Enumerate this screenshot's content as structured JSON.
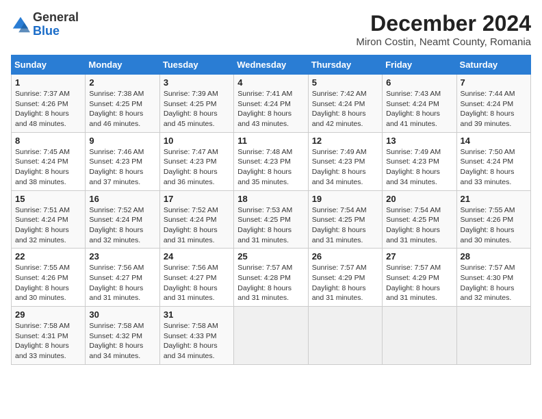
{
  "header": {
    "logo": {
      "general": "General",
      "blue": "Blue"
    },
    "title": "December 2024",
    "subtitle": "Miron Costin, Neamt County, Romania"
  },
  "calendar": {
    "days_of_week": [
      "Sunday",
      "Monday",
      "Tuesday",
      "Wednesday",
      "Thursday",
      "Friday",
      "Saturday"
    ],
    "weeks": [
      [
        {
          "day": "",
          "empty": true
        },
        {
          "day": "",
          "empty": true
        },
        {
          "day": "",
          "empty": true
        },
        {
          "day": "",
          "empty": true
        },
        {
          "day": "",
          "empty": true
        },
        {
          "day": "",
          "empty": true
        },
        {
          "day": "",
          "empty": true
        }
      ],
      [
        {
          "day": "1",
          "sunrise": "7:37 AM",
          "sunset": "4:26 PM",
          "daylight": "8 hours and 48 minutes."
        },
        {
          "day": "2",
          "sunrise": "7:38 AM",
          "sunset": "4:25 PM",
          "daylight": "8 hours and 46 minutes."
        },
        {
          "day": "3",
          "sunrise": "7:39 AM",
          "sunset": "4:25 PM",
          "daylight": "8 hours and 45 minutes."
        },
        {
          "day": "4",
          "sunrise": "7:41 AM",
          "sunset": "4:24 PM",
          "daylight": "8 hours and 43 minutes."
        },
        {
          "day": "5",
          "sunrise": "7:42 AM",
          "sunset": "4:24 PM",
          "daylight": "8 hours and 42 minutes."
        },
        {
          "day": "6",
          "sunrise": "7:43 AM",
          "sunset": "4:24 PM",
          "daylight": "8 hours and 41 minutes."
        },
        {
          "day": "7",
          "sunrise": "7:44 AM",
          "sunset": "4:24 PM",
          "daylight": "8 hours and 39 minutes."
        }
      ],
      [
        {
          "day": "8",
          "sunrise": "7:45 AM",
          "sunset": "4:24 PM",
          "daylight": "8 hours and 38 minutes."
        },
        {
          "day": "9",
          "sunrise": "7:46 AM",
          "sunset": "4:23 PM",
          "daylight": "8 hours and 37 minutes."
        },
        {
          "day": "10",
          "sunrise": "7:47 AM",
          "sunset": "4:23 PM",
          "daylight": "8 hours and 36 minutes."
        },
        {
          "day": "11",
          "sunrise": "7:48 AM",
          "sunset": "4:23 PM",
          "daylight": "8 hours and 35 minutes."
        },
        {
          "day": "12",
          "sunrise": "7:49 AM",
          "sunset": "4:23 PM",
          "daylight": "8 hours and 34 minutes."
        },
        {
          "day": "13",
          "sunrise": "7:49 AM",
          "sunset": "4:23 PM",
          "daylight": "8 hours and 34 minutes."
        },
        {
          "day": "14",
          "sunrise": "7:50 AM",
          "sunset": "4:24 PM",
          "daylight": "8 hours and 33 minutes."
        }
      ],
      [
        {
          "day": "15",
          "sunrise": "7:51 AM",
          "sunset": "4:24 PM",
          "daylight": "8 hours and 32 minutes."
        },
        {
          "day": "16",
          "sunrise": "7:52 AM",
          "sunset": "4:24 PM",
          "daylight": "8 hours and 32 minutes."
        },
        {
          "day": "17",
          "sunrise": "7:52 AM",
          "sunset": "4:24 PM",
          "daylight": "8 hours and 31 minutes."
        },
        {
          "day": "18",
          "sunrise": "7:53 AM",
          "sunset": "4:25 PM",
          "daylight": "8 hours and 31 minutes."
        },
        {
          "day": "19",
          "sunrise": "7:54 AM",
          "sunset": "4:25 PM",
          "daylight": "8 hours and 31 minutes."
        },
        {
          "day": "20",
          "sunrise": "7:54 AM",
          "sunset": "4:25 PM",
          "daylight": "8 hours and 31 minutes."
        },
        {
          "day": "21",
          "sunrise": "7:55 AM",
          "sunset": "4:26 PM",
          "daylight": "8 hours and 30 minutes."
        }
      ],
      [
        {
          "day": "22",
          "sunrise": "7:55 AM",
          "sunset": "4:26 PM",
          "daylight": "8 hours and 30 minutes."
        },
        {
          "day": "23",
          "sunrise": "7:56 AM",
          "sunset": "4:27 PM",
          "daylight": "8 hours and 31 minutes."
        },
        {
          "day": "24",
          "sunrise": "7:56 AM",
          "sunset": "4:27 PM",
          "daylight": "8 hours and 31 minutes."
        },
        {
          "day": "25",
          "sunrise": "7:57 AM",
          "sunset": "4:28 PM",
          "daylight": "8 hours and 31 minutes."
        },
        {
          "day": "26",
          "sunrise": "7:57 AM",
          "sunset": "4:29 PM",
          "daylight": "8 hours and 31 minutes."
        },
        {
          "day": "27",
          "sunrise": "7:57 AM",
          "sunset": "4:29 PM",
          "daylight": "8 hours and 31 minutes."
        },
        {
          "day": "28",
          "sunrise": "7:57 AM",
          "sunset": "4:30 PM",
          "daylight": "8 hours and 32 minutes."
        }
      ],
      [
        {
          "day": "29",
          "sunrise": "7:58 AM",
          "sunset": "4:31 PM",
          "daylight": "8 hours and 33 minutes."
        },
        {
          "day": "30",
          "sunrise": "7:58 AM",
          "sunset": "4:32 PM",
          "daylight": "8 hours and 34 minutes."
        },
        {
          "day": "31",
          "sunrise": "7:58 AM",
          "sunset": "4:33 PM",
          "daylight": "8 hours and 34 minutes."
        },
        {
          "day": "",
          "empty": true
        },
        {
          "day": "",
          "empty": true
        },
        {
          "day": "",
          "empty": true
        },
        {
          "day": "",
          "empty": true
        }
      ]
    ]
  }
}
